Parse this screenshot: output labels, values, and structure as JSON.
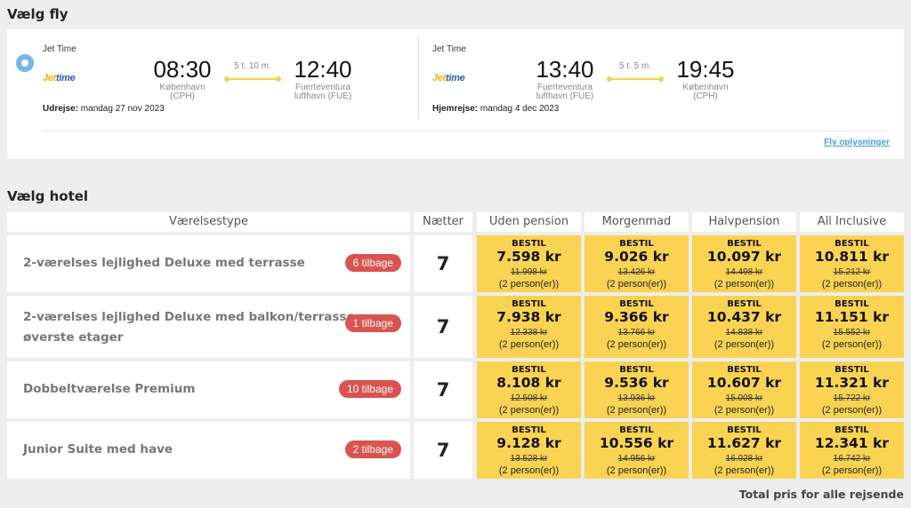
{
  "flights": {
    "title": "Vælg fly",
    "outbound": {
      "airline": "Jet Time",
      "logo_text_a": "Jet",
      "logo_text_b": "time",
      "depart_time": "08:30",
      "depart_place_1": "København",
      "depart_place_2": "(CPH)",
      "duration": "5 t. 10 m.",
      "arrive_time": "12:40",
      "arrive_place_1": "Fuerteventura",
      "arrive_place_2": "lufthavn (FUE)",
      "date_label": "Udrejse:",
      "date_value": "mandag 27 nov 2023"
    },
    "return": {
      "airline": "Jet Time",
      "logo_text_a": "Jet",
      "logo_text_b": "time",
      "depart_time": "13:40",
      "depart_place_1": "Fuerteventura",
      "depart_place_2": "lufthavn (FUE)",
      "duration": "5 t. 5 m.",
      "arrive_time": "19:45",
      "arrive_place_1": "København",
      "arrive_place_2": "(CPH)",
      "date_label": "Hjemrejse:",
      "date_value": "mandag 4 dec 2023"
    },
    "info_link": "Fly oplysninger"
  },
  "hotel": {
    "title": "Vælg hotel",
    "headers": {
      "room_type": "Værelsestype",
      "nights": "Nætter",
      "boards": [
        "Uden pension",
        "Morgenmad",
        "Halvpension",
        "All Inclusive"
      ]
    },
    "book_label": "BESTIL",
    "persons_label": "(2 person(er))",
    "rooms": [
      {
        "name": "2-værelses lejlighed Deluxe med terrasse",
        "availability": "6 tilbage",
        "nights": "7",
        "prices": [
          {
            "price": "7.598 kr",
            "old": "11.998 kr"
          },
          {
            "price": "9.026 kr",
            "old": "13.426 kr"
          },
          {
            "price": "10.097 kr",
            "old": "14.498 kr"
          },
          {
            "price": "10.811 kr",
            "old": "15.212 kr"
          }
        ]
      },
      {
        "name": "2-værelses lejlighed Deluxe med balkon/terrasse,",
        "name_line2": "øverste etager",
        "availability": "1 tilbage",
        "nights": "7",
        "prices": [
          {
            "price": "7.938 kr",
            "old": "12.338 kr"
          },
          {
            "price": "9.366 kr",
            "old": "13.766 kr"
          },
          {
            "price": "10.437 kr",
            "old": "14.838 kr"
          },
          {
            "price": "11.151 kr",
            "old": "15.552 kr"
          }
        ]
      },
      {
        "name": "Dobbeltværelse Premium",
        "availability": "10 tilbage",
        "nights": "7",
        "prices": [
          {
            "price": "8.108 kr",
            "old": "12.508 kr"
          },
          {
            "price": "9.536 kr",
            "old": "13.936 kr"
          },
          {
            "price": "10.607 kr",
            "old": "15.008 kr"
          },
          {
            "price": "11.321 kr",
            "old": "15.722 kr"
          }
        ]
      },
      {
        "name": "Junior Suite med have",
        "availability": "2 tilbage",
        "nights": "7",
        "prices": [
          {
            "price": "9.128 kr",
            "old": "13.528 kr"
          },
          {
            "price": "10.556 kr",
            "old": "14.956 kr"
          },
          {
            "price": "11.627 kr",
            "old": "16.028 kr"
          },
          {
            "price": "12.341 kr",
            "old": "16.742 kr"
          }
        ]
      }
    ],
    "total_label": "Total pris for alle rejsende"
  },
  "colors": {
    "price_cell_bg": "#fad352",
    "badge_bg": "#d9534f",
    "link": "#4a9fd8",
    "radio": "#76b5e6"
  }
}
